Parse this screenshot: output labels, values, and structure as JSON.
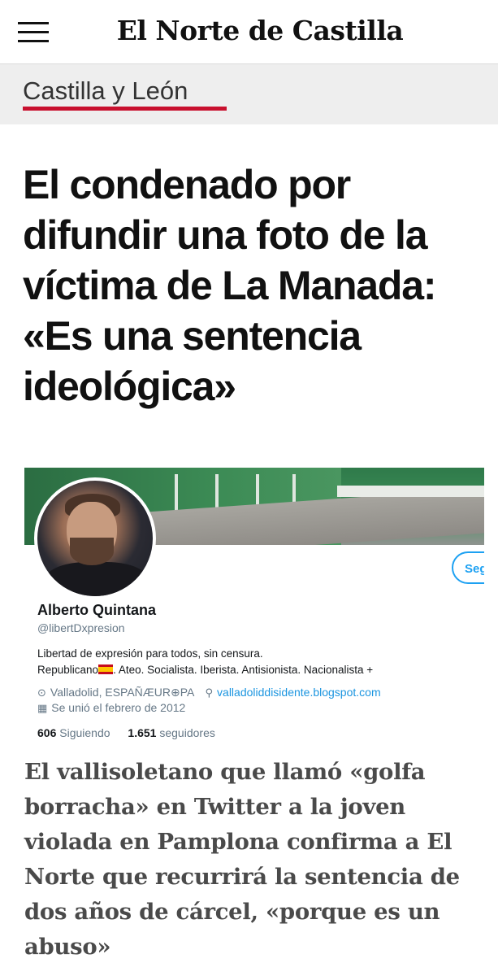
{
  "header": {
    "logo_text": "El Norte de Castilla",
    "menu_icon": "hamburger-menu-icon"
  },
  "section": {
    "label": "Castilla y León",
    "accent_color": "#c8102e"
  },
  "article": {
    "headline": "El condenado por difundir una foto de la víctima de La Manada: «Es una sentencia ideológica»",
    "subtitle": "El vallisoletano que llamó «golfa borracha» en Twitter a la joven violada en Pamplona confirma a El Norte que recurrirá la sentencia de dos años de cárcel, «porque es un abuso»"
  },
  "twitter_card": {
    "name": "Alberto Quintana",
    "handle": "@libertDxpresion",
    "bio_line1": "Libertad de expresión para todos, sin censura.",
    "bio_line2_a": "Republicano",
    "bio_line2_b": ". Ateo. Socialista. Iberista. Antisionista. Nacionalista +",
    "location": "Valladolid, ESPAÑÆUR⊕PA",
    "website": "valladoliddisidente.blogspot.com",
    "joined": "Se unió el febrero de 2012",
    "following_count": "606",
    "following_label": "Siguiendo",
    "followers_count": "1.651",
    "followers_label": "seguidores",
    "follow_button": "Seguir",
    "accent_color": "#1da1f2"
  }
}
